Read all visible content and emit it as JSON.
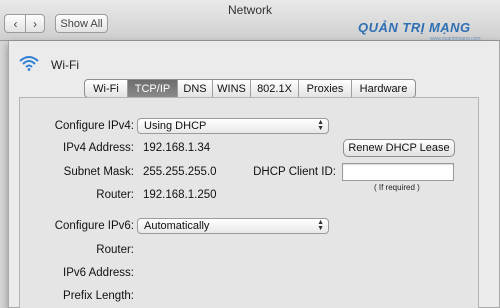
{
  "window": {
    "title": "Network",
    "show_all": "Show All",
    "back": "‹",
    "forward": "›"
  },
  "watermark": {
    "line1": "QUẢN TRỊ MẠNG",
    "line2": "www.quantrimang.com"
  },
  "connection": {
    "name": "Wi-Fi"
  },
  "tabs": [
    {
      "label": "Wi-Fi",
      "selected": false
    },
    {
      "label": "TCP/IP",
      "selected": true
    },
    {
      "label": "DNS",
      "selected": false
    },
    {
      "label": "WINS",
      "selected": false
    },
    {
      "label": "802.1X",
      "selected": false
    },
    {
      "label": "Proxies",
      "selected": false
    },
    {
      "label": "Hardware",
      "selected": false
    }
  ],
  "ipv4": {
    "configure_label": "Configure IPv4:",
    "configure_value": "Using DHCP",
    "address_label": "IPv4 Address:",
    "address_value": "192.168.1.34",
    "subnet_label": "Subnet Mask:",
    "subnet_value": "255.255.255.0",
    "router_label": "Router:",
    "router_value": "192.168.1.250",
    "renew_button": "Renew DHCP Lease",
    "client_id_label": "DHCP Client ID:",
    "client_id_value": "",
    "client_id_hint": "( If required )"
  },
  "ipv6": {
    "configure_label": "Configure IPv6:",
    "configure_value": "Automatically",
    "router_label": "Router:",
    "address_label": "IPv6 Address:",
    "prefix_label": "Prefix Length:"
  },
  "colors": {
    "selected_tab": "#7a7a7a",
    "wifi_icon": "#2e7fd6",
    "watermark": "#2f6fb4"
  }
}
